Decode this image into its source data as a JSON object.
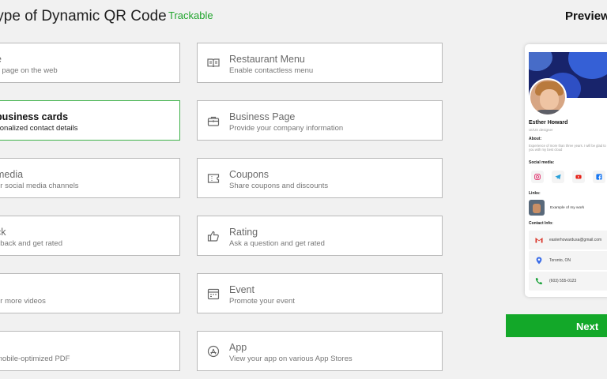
{
  "header": {
    "title": "type of Dynamic QR Code",
    "badge": "Trackable",
    "preview_title": "Preview"
  },
  "left_cards": [
    {
      "title": "e",
      "subtitle": "y page on the web"
    },
    {
      "title": "business cards",
      "subtitle": "sonalized contact details"
    },
    {
      "title": "media",
      "subtitle": "ur social media channels"
    },
    {
      "title": "ck",
      "subtitle": "dback and get rated"
    },
    {
      "title": "",
      "subtitle": "or more videos"
    },
    {
      "title": "",
      "subtitle": "mobile-optimized PDF"
    }
  ],
  "right_cards": [
    {
      "title": "Restaurant Menu",
      "subtitle": "Enable contactless menu",
      "icon": "menu-book-icon"
    },
    {
      "title": "Business Page",
      "subtitle": "Provide your company information",
      "icon": "briefcase-icon"
    },
    {
      "title": "Coupons",
      "subtitle": "Share coupons and discounts",
      "icon": "coupon-icon"
    },
    {
      "title": "Rating",
      "subtitle": "Ask a question and get rated",
      "icon": "thumbs-up-icon"
    },
    {
      "title": "Event",
      "subtitle": "Promote your event",
      "icon": "calendar-icon"
    },
    {
      "title": "App",
      "subtitle": "View your app on various App Stores",
      "icon": "app-store-icon"
    }
  ],
  "selected_card": "business cards",
  "preview": {
    "name": "Esther Howard",
    "role": "UI/UX designer",
    "about_label": "About:",
    "about_text": "Experience of more than three years. I will be glad to help you with my best cloud",
    "social_label": "Social media:",
    "social_icons": [
      "instagram-icon",
      "telegram-icon",
      "youtube-icon",
      "facebook-icon"
    ],
    "links_label": "Links:",
    "link_text": "Example of my work",
    "contact_label": "Contact Info:",
    "email": "easterhowardusa@gmail.com",
    "location": "Toronto, ON",
    "phone": "(603) 555-0123"
  },
  "next_button": "Next",
  "colors": {
    "accent": "#13a829",
    "trackable": "#22a52e",
    "selected_border": "#3fb24b",
    "instagram": "#e1306c",
    "telegram": "#2aa1da",
    "youtube": "#e62117",
    "facebook": "#1877f2"
  }
}
